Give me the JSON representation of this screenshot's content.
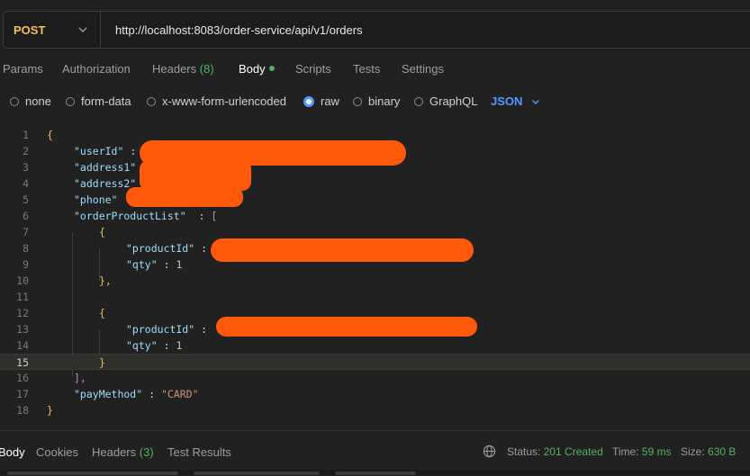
{
  "request": {
    "method": "POST",
    "url": "http://localhost:8083/order-service/api/v1/orders"
  },
  "tabs": {
    "params": "Params",
    "authorization": "Authorization",
    "headers": "Headers",
    "headers_count": "(8)",
    "body": "Body",
    "scripts": "Scripts",
    "tests": "Tests",
    "settings": "Settings"
  },
  "body_options": {
    "none": "none",
    "form_data": "form-data",
    "urlencoded": "x-www-form-urlencoded",
    "raw": "raw",
    "binary": "binary",
    "graphql": "GraphQL",
    "format": "JSON",
    "selected": "raw"
  },
  "editor": {
    "line_numbers": [
      "1",
      "2",
      "3",
      "4",
      "5",
      "6",
      "7",
      "8",
      "9",
      "10",
      "11",
      "12",
      "13",
      "14",
      "15",
      "16",
      "17",
      "18"
    ],
    "current_line": "15",
    "lines": {
      "l1": "{",
      "l2_key": "\"userId\"",
      "l3_key": "\"address1\"",
      "l4_key": "\"address2\"",
      "l5_key": "\"phone\"",
      "l6_key": "\"orderProductList\"",
      "l6_open": "[",
      "l7": "{",
      "l8_key": "\"productId\"",
      "l9_key": "\"qty\"",
      "l9_val": "1",
      "l10": "},",
      "l12": "{",
      "l13_key": "\"productId\"",
      "l14_key": "\"qty\"",
      "l14_val": "1",
      "l15": "}",
      "l16": "],",
      "l17_key": "\"payMethod\"",
      "l17_val": "\"CARD\"",
      "l18": "}",
      "colon": ":"
    }
  },
  "response": {
    "tabs": {
      "body": "Body",
      "cookies": "Cookies",
      "headers": "Headers",
      "headers_count": "(3)",
      "test_results": "Test Results"
    },
    "status_label": "Status:",
    "status_value": "201 Created",
    "time_label": "Time:",
    "time_value": "59 ms",
    "size_label": "Size:",
    "size_value": "630 B"
  },
  "colors": {
    "accent_blue": "#4d9bff",
    "success_green": "#4fb35f",
    "method_yellow": "#f2c14e",
    "redaction_orange": "#ff5a0a"
  },
  "icons": {
    "method_dropdown": "chevron-down-icon",
    "format_dropdown": "chevron-down-icon",
    "network": "globe-icon"
  }
}
